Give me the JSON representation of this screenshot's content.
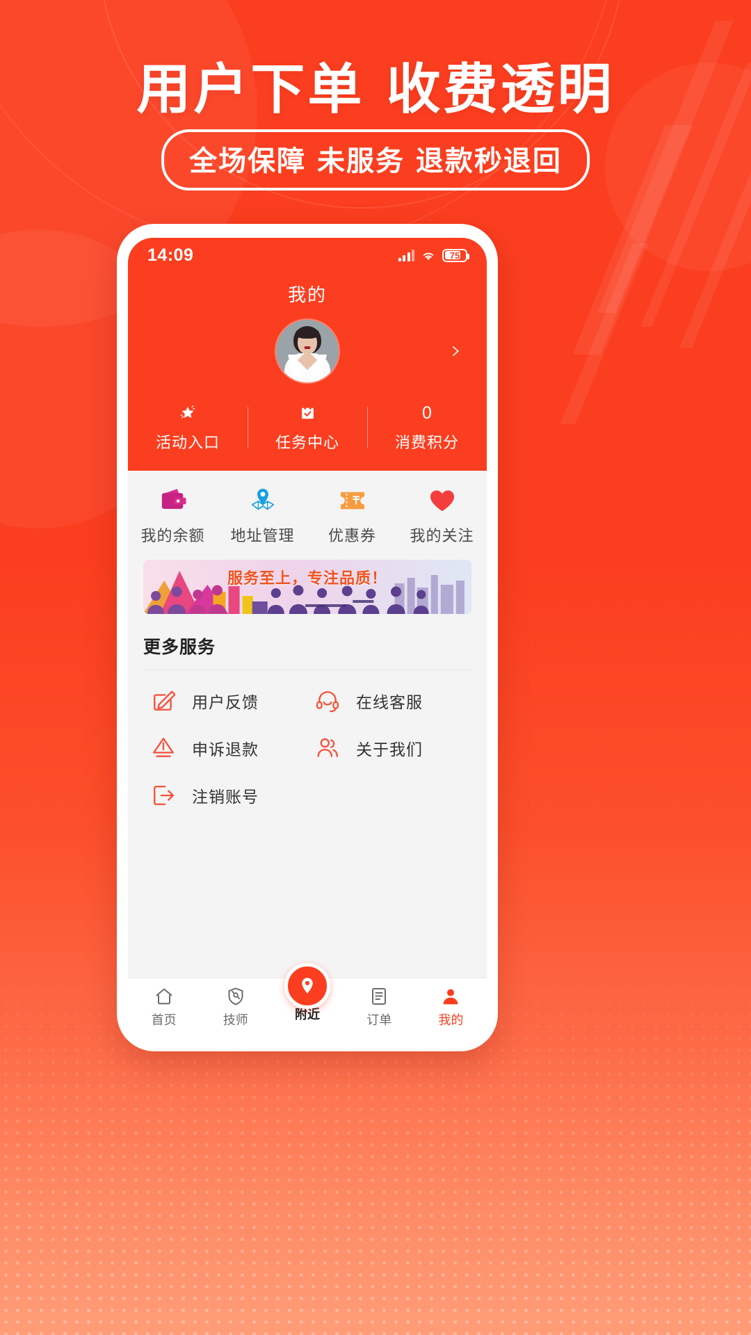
{
  "poster": {
    "headline": "用户下单 收费透明",
    "subtitle": "全场保障 未服务 退款秒退回",
    "accent": "#fb3e1f"
  },
  "phone": {
    "status_bar": {
      "time": "14:09",
      "battery_level": "75",
      "signal_icon": "signal-bars-icon",
      "wifi_icon": "wifi-icon",
      "battery_icon": "battery-icon"
    },
    "header": {
      "title": "我的",
      "avatar_icon": "user-avatar",
      "chevron_icon": "chevron-right-icon",
      "stats": [
        {
          "icon": "star-icon",
          "value": "",
          "label": "活动入口"
        },
        {
          "icon": "calendar-check-icon",
          "value": "",
          "label": "任务中心"
        },
        {
          "icon": "",
          "value": "0",
          "label": "消费积分"
        }
      ]
    },
    "shortcuts": [
      {
        "icon": "wallet-icon",
        "label": "我的余额",
        "color": "#c62183"
      },
      {
        "icon": "map-pin-icon",
        "label": "地址管理",
        "color": "#1a9fe0"
      },
      {
        "icon": "coupon-icon",
        "label": "优惠券",
        "color": "#f79b41"
      },
      {
        "icon": "heart-icon",
        "label": "我的关注",
        "color": "#f43d3d"
      }
    ],
    "banner": {
      "text": "服务至上，专注品质！",
      "text_color": "#f0541f"
    },
    "more_services": {
      "title": "更多服务",
      "items": [
        {
          "icon": "edit-square-icon",
          "label": "用户反馈"
        },
        {
          "icon": "headset-icon",
          "label": "在线客服"
        },
        {
          "icon": "appeal-refund-icon",
          "label": "申诉退款"
        },
        {
          "icon": "users-icon",
          "label": "关于我们"
        },
        {
          "icon": "logout-icon",
          "label": "注销账号"
        }
      ]
    },
    "tabbar": {
      "items": [
        {
          "icon": "home-icon",
          "label": "首页",
          "active": false
        },
        {
          "icon": "technician-icon",
          "label": "技师",
          "active": false
        },
        {
          "icon": "location-pin-icon",
          "label": "附近",
          "active": true,
          "center": true
        },
        {
          "icon": "orders-icon",
          "label": "订单",
          "active": false
        },
        {
          "icon": "profile-icon",
          "label": "我的",
          "active": false
        }
      ]
    }
  }
}
